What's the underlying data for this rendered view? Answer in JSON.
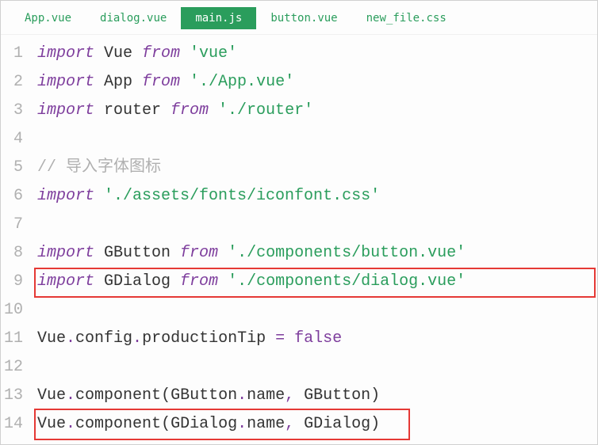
{
  "tabs": [
    {
      "label": "App.vue",
      "active": false
    },
    {
      "label": "dialog.vue",
      "active": false
    },
    {
      "label": "main.js",
      "active": true
    },
    {
      "label": "button.vue",
      "active": false
    },
    {
      "label": "new_file.css",
      "active": false
    }
  ],
  "lineNumbers": [
    "1",
    "2",
    "3",
    "4",
    "5",
    "6",
    "7",
    "8",
    "9",
    "10",
    "11",
    "12",
    "13",
    "14"
  ],
  "code": {
    "l1": {
      "kw1": "import",
      "id": " Vue ",
      "kw2": "from",
      "str": " 'vue'"
    },
    "l2": {
      "kw1": "import",
      "id": " App ",
      "kw2": "from",
      "str": " './App.vue'"
    },
    "l3": {
      "kw1": "import",
      "id": " router ",
      "kw2": "from",
      "str": " './router'"
    },
    "l5": {
      "cmt": "// 导入字体图标"
    },
    "l6": {
      "kw1": "import",
      "str": " './assets/fonts/iconfont.css'"
    },
    "l8": {
      "kw1": "import",
      "id": " GButton ",
      "kw2": "from",
      "str": " './components/button.vue'"
    },
    "l9": {
      "kw1": "import",
      "id": " GDialog ",
      "kw2": "from",
      "str": " './components/dialog.vue'"
    },
    "l11": {
      "t1": "Vue",
      "d1": ".",
      "t2": "config",
      "d2": ".",
      "t3": "productionTip ",
      "op": "=",
      "bool": " false"
    },
    "l13": {
      "t1": "Vue",
      "d1": ".",
      "t2": "component",
      "p1": "(",
      "t3": "GButton",
      "d2": ".",
      "t4": "name",
      "c": ",",
      "t5": " GButton",
      "p2": ")"
    },
    "l14": {
      "t1": "Vue",
      "d1": ".",
      "t2": "component",
      "p1": "(",
      "t3": "GDialog",
      "d2": ".",
      "t4": "name",
      "c": ",",
      "t5": " GDialog",
      "p2": ")"
    }
  }
}
